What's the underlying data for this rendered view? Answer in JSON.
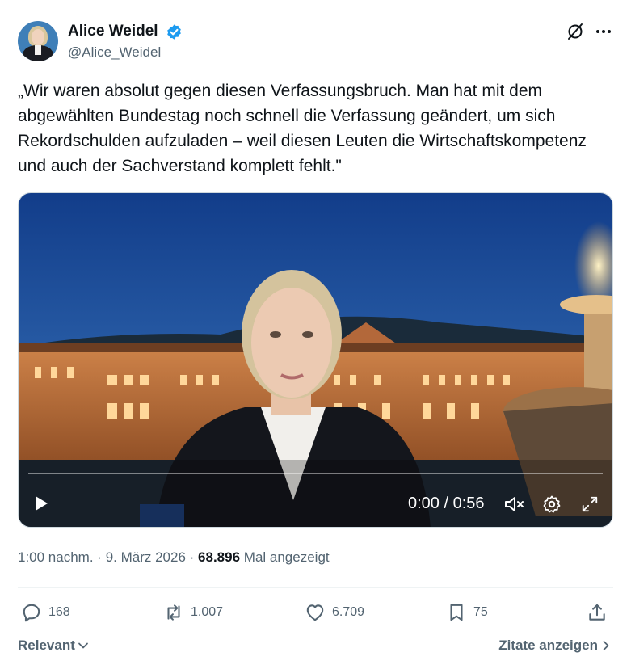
{
  "author": {
    "name": "Alice Weidel",
    "handle": "@Alice_Weidel",
    "verified": true
  },
  "tweet": {
    "text": "„Wir waren absolut gegen diesen Verfassungsbruch. Man hat mit dem abgewählten Bundestag noch schnell die Verfassung geändert, um sich Rekordschulden aufzuladen – weil diesen Leuten die Wirtschaftskompetenz und auch der Sachverstand komplett fehlt.\""
  },
  "video": {
    "time_display": "0:00 / 0:56",
    "progress": 0
  },
  "meta": {
    "time": "1:00 nachm.",
    "date": "9. März 2026",
    "views": "68.896",
    "views_label": "Mal angezeigt"
  },
  "actions": {
    "replies": "168",
    "reposts": "1.007",
    "likes": "6.709",
    "bookmarks": "75"
  },
  "footer": {
    "sort_label": "Relevant",
    "quotes_label": "Zitate anzeigen"
  },
  "colors": {
    "verified": "#1d9bf0",
    "text": "#0f1419",
    "muted": "#536471"
  }
}
